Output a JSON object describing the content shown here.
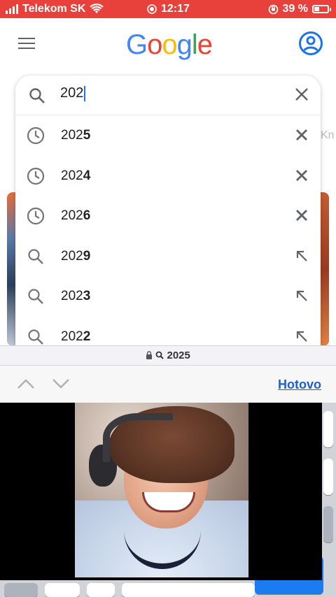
{
  "status_bar": {
    "carrier": "Telekom SK",
    "time": "12:17",
    "battery_percent": "39 %",
    "battery_level": 0.39
  },
  "header": {
    "logo_letters": [
      "G",
      "o",
      "o",
      "g",
      "l",
      "e"
    ],
    "menu_icon": "hamburger-menu-icon",
    "account_icon": "account-circle-icon"
  },
  "search": {
    "query": "202",
    "clear_icon": "close-icon"
  },
  "suggestions": [
    {
      "prefix": "202",
      "completion": "5",
      "type": "history",
      "action_icon": "remove-icon"
    },
    {
      "prefix": "202",
      "completion": "4",
      "type": "history",
      "action_icon": "remove-icon"
    },
    {
      "prefix": "202",
      "completion": "6",
      "type": "history",
      "action_icon": "remove-icon"
    },
    {
      "prefix": "202",
      "completion": "9",
      "type": "search",
      "action_icon": "fill-query-arrow-icon"
    },
    {
      "prefix": "202",
      "completion": "3",
      "type": "search",
      "action_icon": "fill-query-arrow-icon"
    },
    {
      "prefix": "202",
      "completion": "2",
      "type": "search",
      "action_icon": "fill-query-arrow-icon"
    }
  ],
  "peek_text": "Kn",
  "find_bar": {
    "url_text": "2025",
    "done_label": "Hotovo"
  },
  "colors": {
    "status_bar_bg": "#e8413b",
    "google_blue": "#4285f4",
    "link_blue": "#1f5fd0"
  }
}
